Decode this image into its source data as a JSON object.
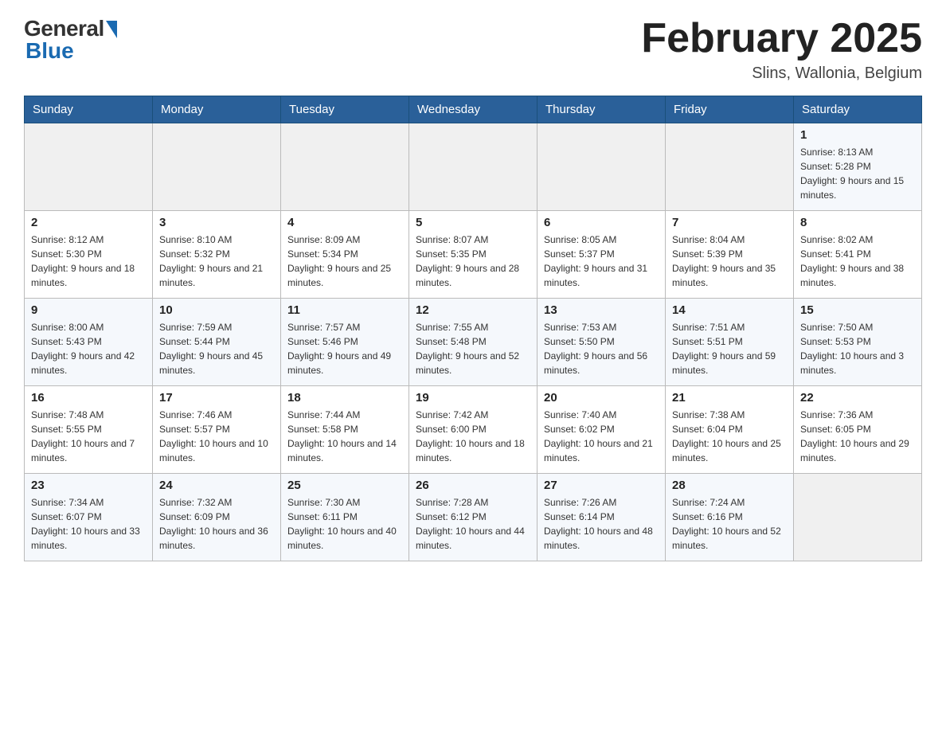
{
  "header": {
    "logo_general": "General",
    "logo_blue": "Blue",
    "title": "February 2025",
    "location": "Slins, Wallonia, Belgium"
  },
  "days_of_week": [
    "Sunday",
    "Monday",
    "Tuesday",
    "Wednesday",
    "Thursday",
    "Friday",
    "Saturday"
  ],
  "weeks": [
    {
      "days": [
        {
          "num": "",
          "info": ""
        },
        {
          "num": "",
          "info": ""
        },
        {
          "num": "",
          "info": ""
        },
        {
          "num": "",
          "info": ""
        },
        {
          "num": "",
          "info": ""
        },
        {
          "num": "",
          "info": ""
        },
        {
          "num": "1",
          "info": "Sunrise: 8:13 AM\nSunset: 5:28 PM\nDaylight: 9 hours and 15 minutes."
        }
      ]
    },
    {
      "days": [
        {
          "num": "2",
          "info": "Sunrise: 8:12 AM\nSunset: 5:30 PM\nDaylight: 9 hours and 18 minutes."
        },
        {
          "num": "3",
          "info": "Sunrise: 8:10 AM\nSunset: 5:32 PM\nDaylight: 9 hours and 21 minutes."
        },
        {
          "num": "4",
          "info": "Sunrise: 8:09 AM\nSunset: 5:34 PM\nDaylight: 9 hours and 25 minutes."
        },
        {
          "num": "5",
          "info": "Sunrise: 8:07 AM\nSunset: 5:35 PM\nDaylight: 9 hours and 28 minutes."
        },
        {
          "num": "6",
          "info": "Sunrise: 8:05 AM\nSunset: 5:37 PM\nDaylight: 9 hours and 31 minutes."
        },
        {
          "num": "7",
          "info": "Sunrise: 8:04 AM\nSunset: 5:39 PM\nDaylight: 9 hours and 35 minutes."
        },
        {
          "num": "8",
          "info": "Sunrise: 8:02 AM\nSunset: 5:41 PM\nDaylight: 9 hours and 38 minutes."
        }
      ]
    },
    {
      "days": [
        {
          "num": "9",
          "info": "Sunrise: 8:00 AM\nSunset: 5:43 PM\nDaylight: 9 hours and 42 minutes."
        },
        {
          "num": "10",
          "info": "Sunrise: 7:59 AM\nSunset: 5:44 PM\nDaylight: 9 hours and 45 minutes."
        },
        {
          "num": "11",
          "info": "Sunrise: 7:57 AM\nSunset: 5:46 PM\nDaylight: 9 hours and 49 minutes."
        },
        {
          "num": "12",
          "info": "Sunrise: 7:55 AM\nSunset: 5:48 PM\nDaylight: 9 hours and 52 minutes."
        },
        {
          "num": "13",
          "info": "Sunrise: 7:53 AM\nSunset: 5:50 PM\nDaylight: 9 hours and 56 minutes."
        },
        {
          "num": "14",
          "info": "Sunrise: 7:51 AM\nSunset: 5:51 PM\nDaylight: 9 hours and 59 minutes."
        },
        {
          "num": "15",
          "info": "Sunrise: 7:50 AM\nSunset: 5:53 PM\nDaylight: 10 hours and 3 minutes."
        }
      ]
    },
    {
      "days": [
        {
          "num": "16",
          "info": "Sunrise: 7:48 AM\nSunset: 5:55 PM\nDaylight: 10 hours and 7 minutes."
        },
        {
          "num": "17",
          "info": "Sunrise: 7:46 AM\nSunset: 5:57 PM\nDaylight: 10 hours and 10 minutes."
        },
        {
          "num": "18",
          "info": "Sunrise: 7:44 AM\nSunset: 5:58 PM\nDaylight: 10 hours and 14 minutes."
        },
        {
          "num": "19",
          "info": "Sunrise: 7:42 AM\nSunset: 6:00 PM\nDaylight: 10 hours and 18 minutes."
        },
        {
          "num": "20",
          "info": "Sunrise: 7:40 AM\nSunset: 6:02 PM\nDaylight: 10 hours and 21 minutes."
        },
        {
          "num": "21",
          "info": "Sunrise: 7:38 AM\nSunset: 6:04 PM\nDaylight: 10 hours and 25 minutes."
        },
        {
          "num": "22",
          "info": "Sunrise: 7:36 AM\nSunset: 6:05 PM\nDaylight: 10 hours and 29 minutes."
        }
      ]
    },
    {
      "days": [
        {
          "num": "23",
          "info": "Sunrise: 7:34 AM\nSunset: 6:07 PM\nDaylight: 10 hours and 33 minutes."
        },
        {
          "num": "24",
          "info": "Sunrise: 7:32 AM\nSunset: 6:09 PM\nDaylight: 10 hours and 36 minutes."
        },
        {
          "num": "25",
          "info": "Sunrise: 7:30 AM\nSunset: 6:11 PM\nDaylight: 10 hours and 40 minutes."
        },
        {
          "num": "26",
          "info": "Sunrise: 7:28 AM\nSunset: 6:12 PM\nDaylight: 10 hours and 44 minutes."
        },
        {
          "num": "27",
          "info": "Sunrise: 7:26 AM\nSunset: 6:14 PM\nDaylight: 10 hours and 48 minutes."
        },
        {
          "num": "28",
          "info": "Sunrise: 7:24 AM\nSunset: 6:16 PM\nDaylight: 10 hours and 52 minutes."
        },
        {
          "num": "",
          "info": ""
        }
      ]
    }
  ]
}
